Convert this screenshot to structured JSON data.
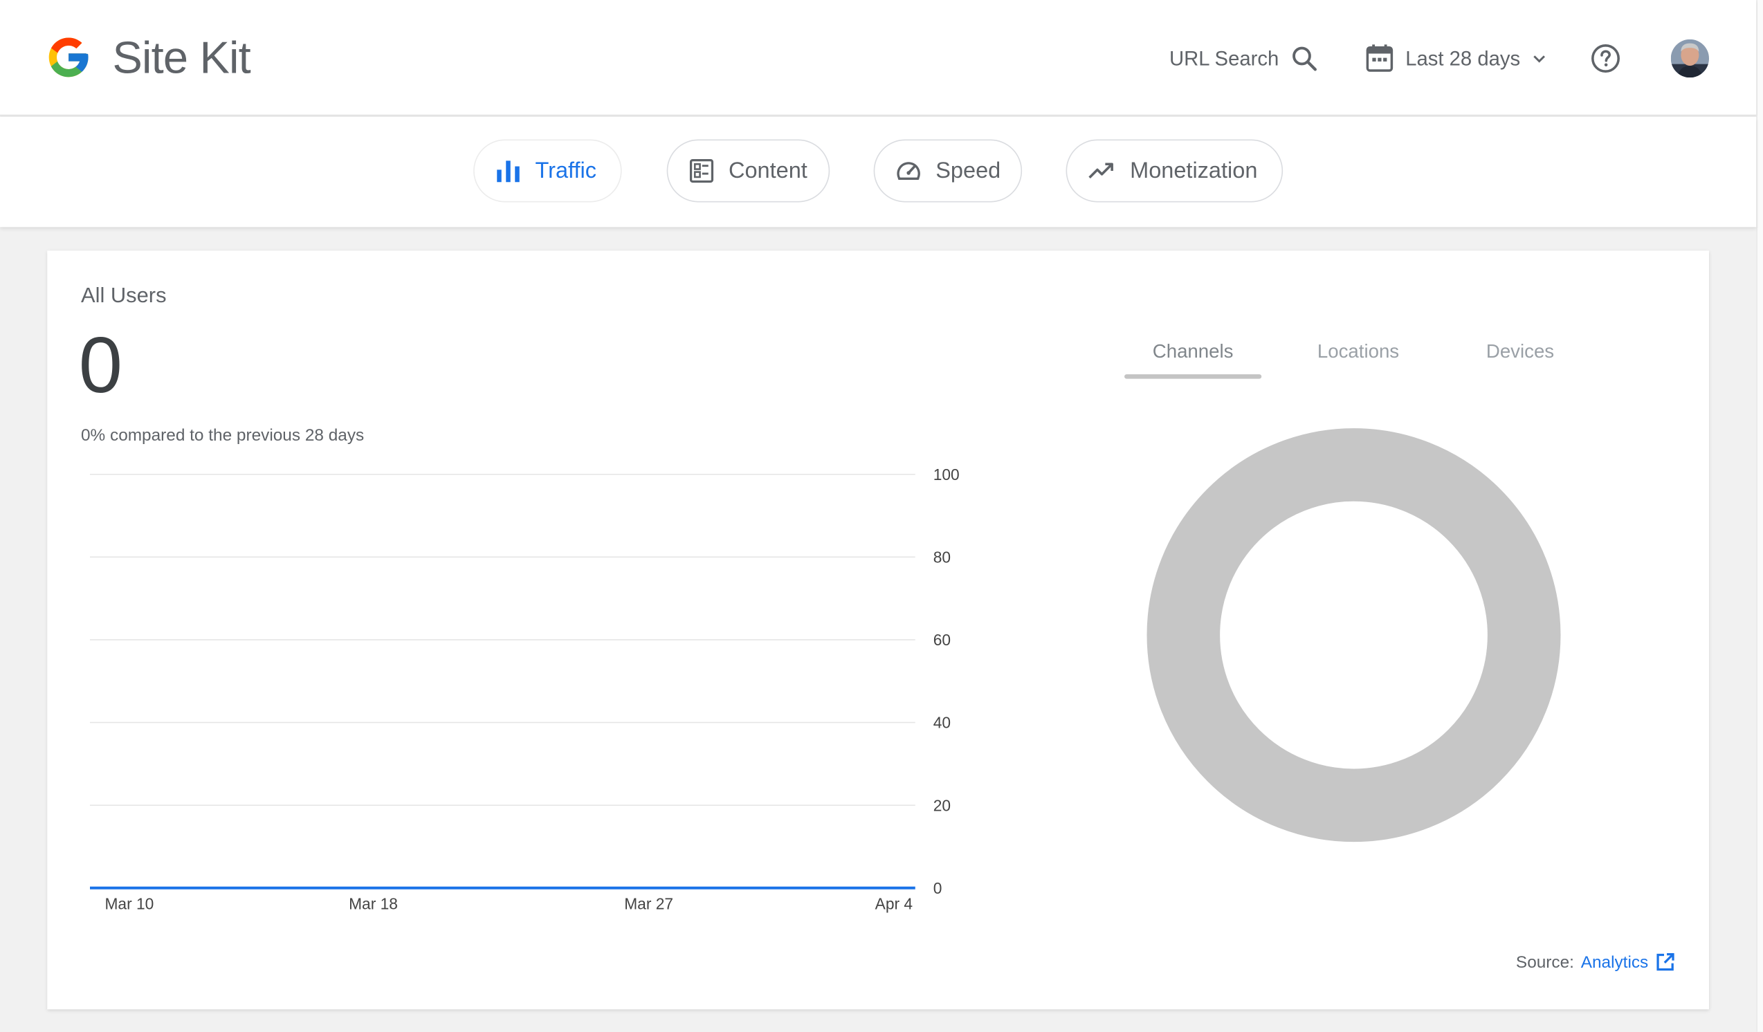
{
  "header": {
    "app_name": "Site Kit",
    "url_search_label": "URL Search",
    "date_range_label": "Last 28 days"
  },
  "nav": {
    "tabs": [
      {
        "label": "Traffic",
        "icon": "bar-chart-icon",
        "active": true
      },
      {
        "label": "Content",
        "icon": "article-icon",
        "active": false
      },
      {
        "label": "Speed",
        "icon": "speedometer-icon",
        "active": false
      },
      {
        "label": "Monetization",
        "icon": "trending-up-icon",
        "active": false
      }
    ]
  },
  "card": {
    "title": "All Users",
    "value": "0",
    "comparison": "0% compared to the previous 28 days",
    "source_label": "Source:",
    "source_link": "Analytics",
    "dimension_tabs": [
      "Channels",
      "Locations",
      "Devices"
    ],
    "active_dimension": "Channels"
  },
  "colors": {
    "accent": "#1a73e8",
    "donut": "#c6c6c6"
  },
  "chart_data": {
    "type": "line",
    "x": [
      "Mar 10",
      "Mar 18",
      "Mar 27",
      "Apr 4"
    ],
    "series": [
      {
        "values": [
          0,
          0,
          0,
          0
        ]
      }
    ],
    "y_ticks": [
      0,
      20,
      40,
      60,
      80,
      100
    ],
    "ylim": [
      0,
      100
    ],
    "grid": true,
    "y_axis_side": "right"
  },
  "donut_data": {
    "type": "pie",
    "values": [
      1
    ],
    "color": "#c6c6c6"
  }
}
